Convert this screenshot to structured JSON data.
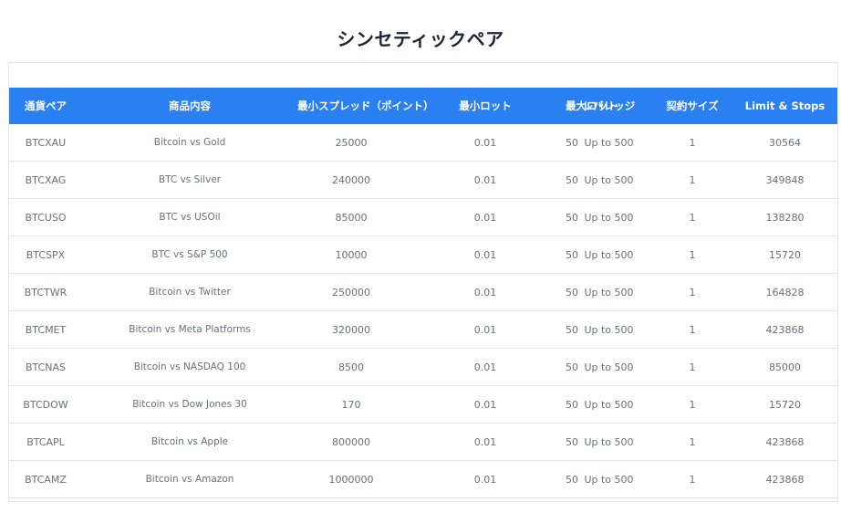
{
  "page": {
    "title": "シンセティックペア"
  },
  "table": {
    "headers": [
      "通貨ペア",
      "商品内容",
      "最小スプレッド（ポイント）",
      "最小ロット",
      "最大ロット",
      "レバレッジ",
      "契約サイズ",
      "Limit & Stops"
    ],
    "rows": [
      [
        "BTCXAU",
        "Bitcoin vs Gold",
        "25000",
        "0.01",
        "50",
        "Up to 500",
        "1",
        "30564"
      ],
      [
        "BTCXAG",
        "BTC vs Silver",
        "240000",
        "0.01",
        "50",
        "Up to 500",
        "1",
        "349848"
      ],
      [
        "BTCUSO",
        "BTC vs USOil",
        "85000",
        "0.01",
        "50",
        "Up to 500",
        "1",
        "138280"
      ],
      [
        "BTCSPX",
        "BTC vs S&P 500",
        "10000",
        "0.01",
        "50",
        "Up to 500",
        "1",
        "15720"
      ],
      [
        "BTCTWR",
        "Bitcoin vs Twitter",
        "250000",
        "0.01",
        "50",
        "Up to 500",
        "1",
        "164828"
      ],
      [
        "BTCMET",
        "Bitcoin vs Meta Platforms",
        "320000",
        "0.01",
        "50",
        "Up to 500",
        "1",
        "423868"
      ],
      [
        "BTCNAS",
        "Bitcoin vs NASDAQ 100",
        "8500",
        "0.01",
        "50",
        "Up to 500",
        "1",
        "85000"
      ],
      [
        "BTCDOW",
        "Bitcoin vs Dow Jones 30",
        "170",
        "0.01",
        "50",
        "Up to 500",
        "1",
        "15720"
      ],
      [
        "BTCAPL",
        "Bitcoin vs Apple",
        "800000",
        "0.01",
        "50",
        "Up to 500",
        "1",
        "423868"
      ],
      [
        "BTCAMZ",
        "Bitcoin vs Amazon",
        "1000000",
        "0.01",
        "50",
        "Up to 500",
        "1",
        "423868"
      ]
    ]
  },
  "colors": {
    "header_background": "#2a7ff1",
    "header_text": "#ffffff",
    "title_text": "#1d2433",
    "cell_text": "#6b6f78",
    "row_divider": "#e3e5e9"
  }
}
